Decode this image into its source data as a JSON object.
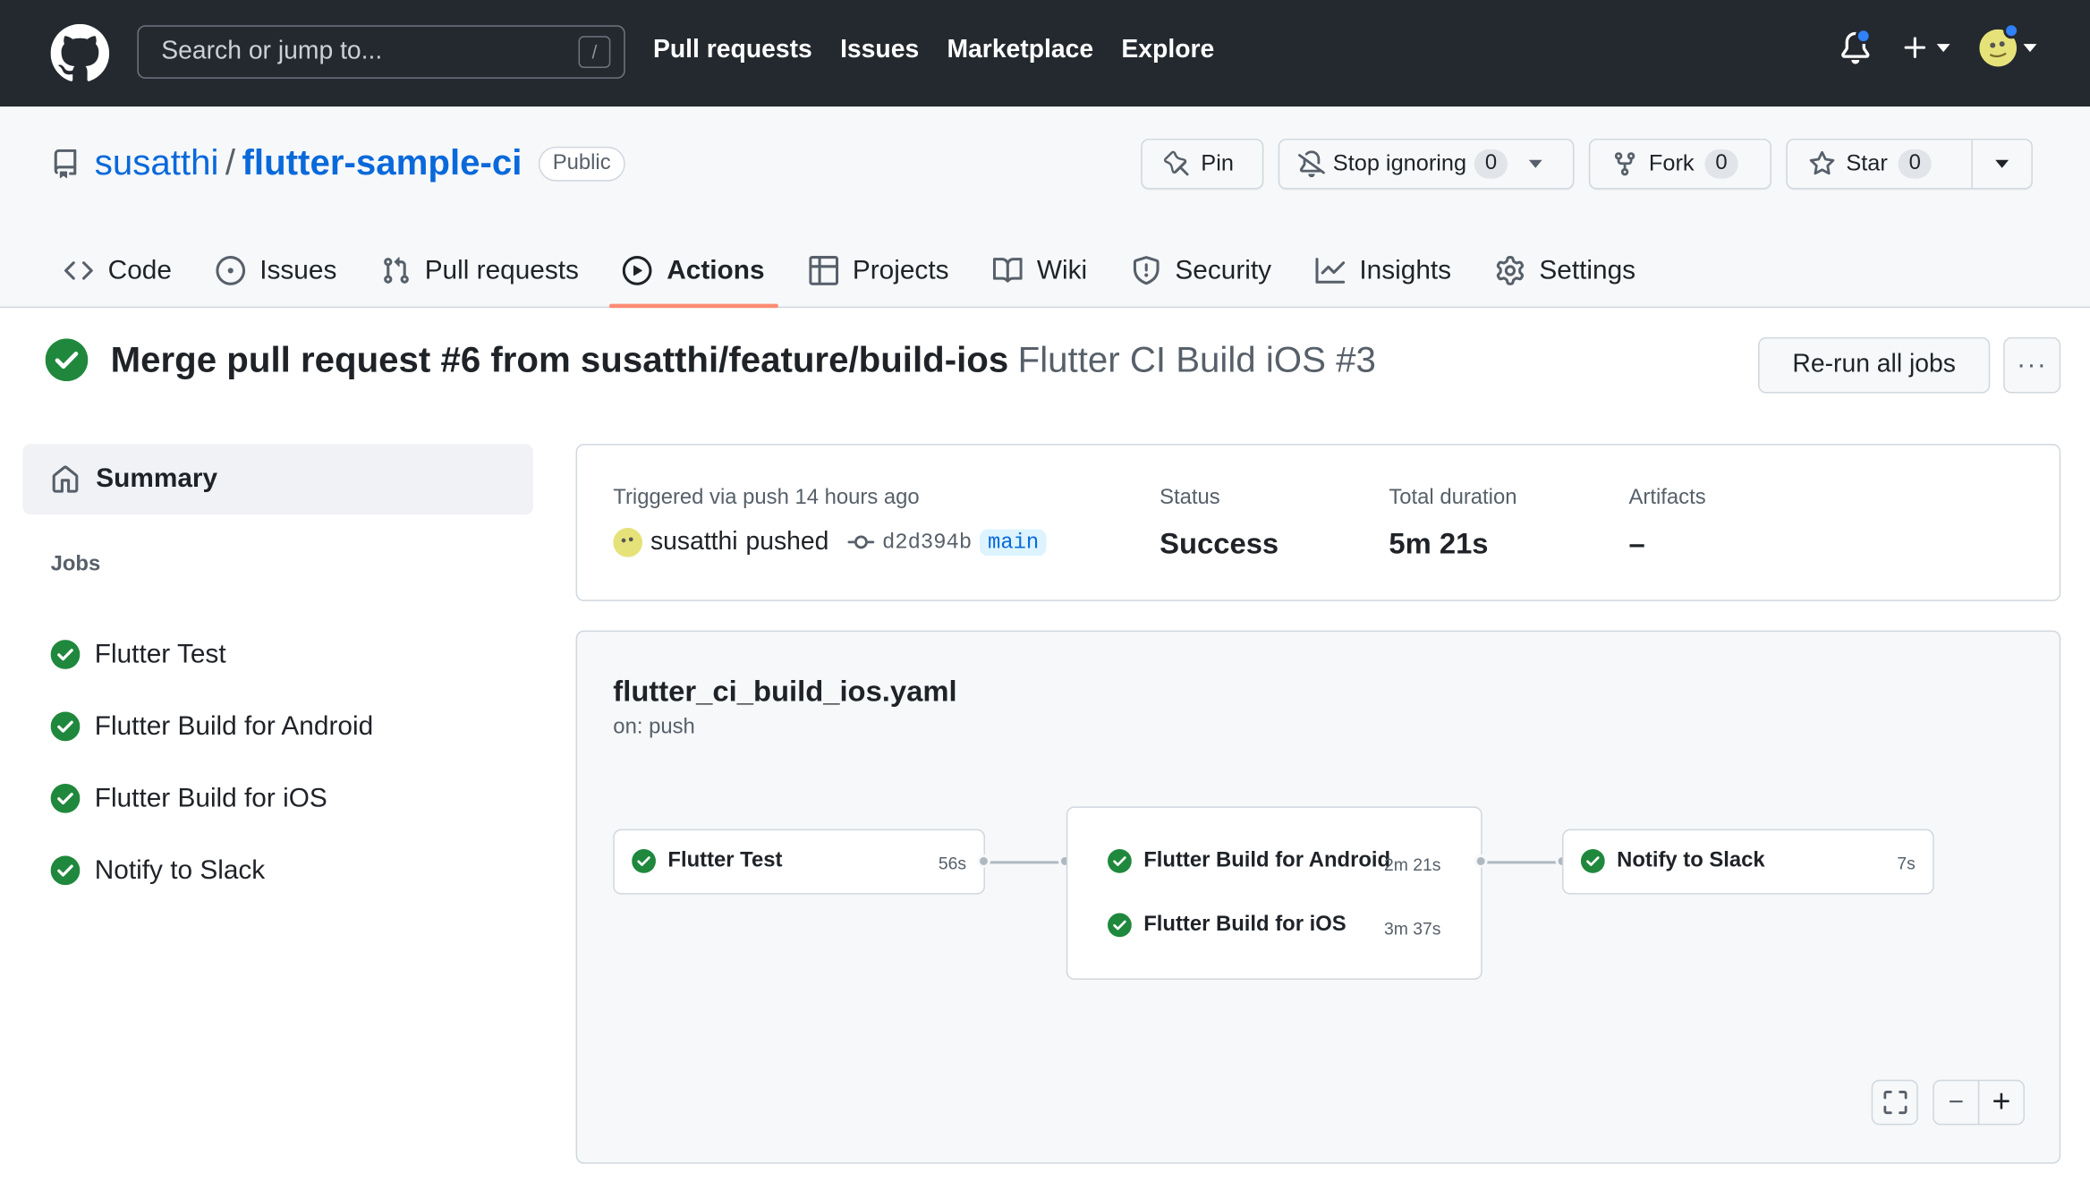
{
  "header": {
    "search_placeholder": "Search or jump to...",
    "search_shortcut": "/",
    "nav": [
      "Pull requests",
      "Issues",
      "Marketplace",
      "Explore"
    ]
  },
  "repo": {
    "owner": "susatthi",
    "separator": "/",
    "name": "flutter-sample-ci",
    "visibility": "Public",
    "pin_label": "Pin",
    "watch_label": "Stop ignoring",
    "watch_count": "0",
    "fork_label": "Fork",
    "fork_count": "0",
    "star_label": "Star",
    "star_count": "0"
  },
  "tabs": [
    "Code",
    "Issues",
    "Pull requests",
    "Actions",
    "Projects",
    "Wiki",
    "Security",
    "Insights",
    "Settings"
  ],
  "run": {
    "title": "Merge pull request #6 from susatthi/feature/build-ios",
    "subtitle": "Flutter CI Build iOS #3",
    "rerun_label": "Re-run all jobs",
    "more_label": "···"
  },
  "sidebar": {
    "summary_label": "Summary",
    "jobs_heading": "Jobs",
    "jobs": [
      "Flutter Test",
      "Flutter Build for Android",
      "Flutter Build for iOS",
      "Notify to Slack"
    ]
  },
  "summary": {
    "triggered_label": "Triggered via push 14 hours ago",
    "actor": "susatthi",
    "action": "pushed",
    "commit": "d2d394b",
    "branch": "main",
    "status_label": "Status",
    "status_value": "Success",
    "duration_label": "Total duration",
    "duration_value": "5m 21s",
    "artifacts_label": "Artifacts",
    "artifacts_value": "–"
  },
  "workflow": {
    "file": "flutter_ci_build_ios.yaml",
    "trigger": "on: push",
    "nodes": [
      {
        "name": "Flutter Test",
        "duration": "56s"
      },
      {
        "name": "Flutter Build for Android",
        "duration": "2m 21s"
      },
      {
        "name": "Flutter Build for iOS",
        "duration": "3m 37s"
      },
      {
        "name": "Notify to Slack",
        "duration": "7s"
      }
    ],
    "zoom_out_label": "−",
    "zoom_in_label": "+"
  },
  "colors": {
    "success": "#1f883d",
    "link": "#0969da",
    "header_bg": "#24292f",
    "active_tab": "#fd8c73"
  },
  "icons": [
    "github-logo-icon",
    "bell-icon",
    "plus-icon",
    "avatar",
    "repo-icon",
    "pin-icon",
    "bell-slash-icon",
    "fork-icon",
    "star-icon",
    "code-icon",
    "issue-icon",
    "pull-request-icon",
    "play-icon",
    "table-icon",
    "book-icon",
    "shield-icon",
    "graph-icon",
    "gear-icon",
    "check-circle-icon",
    "home-icon",
    "commit-icon",
    "fullscreen-icon"
  ]
}
